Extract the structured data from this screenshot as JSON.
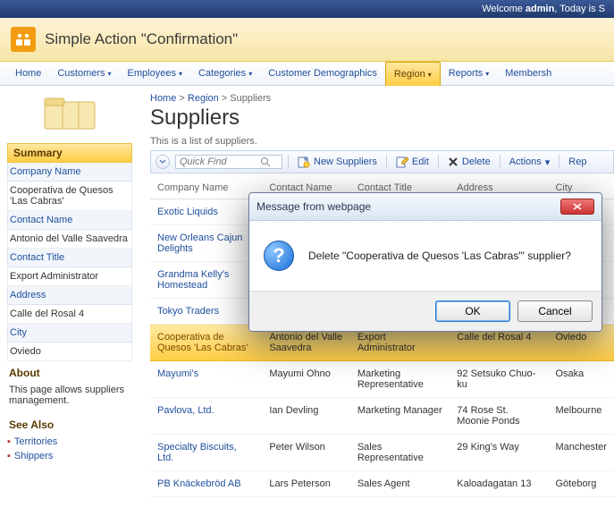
{
  "topbar": {
    "welcome": "Welcome ",
    "user": "admin",
    "today": ", Today is S"
  },
  "header": {
    "title": "Simple Action \"Confirmation\""
  },
  "nav": {
    "items": [
      {
        "label": "Home",
        "dd": false
      },
      {
        "label": "Customers",
        "dd": true
      },
      {
        "label": "Employees",
        "dd": true
      },
      {
        "label": "Categories",
        "dd": true
      },
      {
        "label": "Customer Demographics"
      },
      {
        "label": "Region",
        "dd": true,
        "active": true
      },
      {
        "label": "Reports",
        "dd": true
      },
      {
        "label": "Membersh"
      }
    ]
  },
  "sidebar": {
    "summary_title": "Summary",
    "fields": [
      {
        "label": "Company Name",
        "value": "Cooperativa de Quesos 'Las Cabras'"
      },
      {
        "label": "Contact Name",
        "value": "Antonio del Valle Saavedra"
      },
      {
        "label": "Contact Title",
        "value": "Export Administrator"
      },
      {
        "label": "Address",
        "value": "Calle del Rosal 4"
      },
      {
        "label": "City",
        "value": "Oviedo"
      }
    ],
    "about_title": "About",
    "about_text": "This page allows suppliers management.",
    "seealso_title": "See Also",
    "seealso": [
      "Territories",
      "Shippers"
    ]
  },
  "breadcrumb": {
    "a": "Home",
    "b": "Region",
    "c": "Suppliers"
  },
  "page": {
    "title": "Suppliers",
    "sub": "This is a list of suppliers."
  },
  "toolbar": {
    "search_placeholder": "Quick Find",
    "new": "New Suppliers",
    "edit": "Edit",
    "delete": "Delete",
    "actions": "Actions",
    "report": "Rep"
  },
  "columns": [
    "Company Name",
    "Contact Name",
    "Contact Title",
    "Address",
    "City"
  ],
  "rows": [
    {
      "c": [
        "Exotic Liquids",
        "",
        "",
        "",
        ""
      ]
    },
    {
      "c": [
        "New Orleans Cajun Delights",
        "",
        "",
        "",
        ""
      ]
    },
    {
      "c": [
        "Grandma Kelly's Homestead",
        "",
        "",
        "",
        ""
      ]
    },
    {
      "c": [
        "Tokyo Traders",
        "",
        "",
        "",
        ""
      ]
    },
    {
      "c": [
        "Cooperativa de Quesos 'Las Cabras'",
        "Antonio del Valle Saavedra",
        "Export Administrator",
        "Calle del Rosal 4",
        "Oviedo"
      ],
      "selected": true
    },
    {
      "c": [
        "Mayumi's",
        "Mayumi Ohno",
        "Marketing Representative",
        "92 Setsuko Chuo-ku",
        "Osaka"
      ]
    },
    {
      "c": [
        "Pavlova, Ltd.",
        "Ian Devling",
        "Marketing Manager",
        "74 Rose St. Moonie Ponds",
        "Melbourne"
      ]
    },
    {
      "c": [
        "Specialty Biscuits, Ltd.",
        "Peter Wilson",
        "Sales Representative",
        "29 King's Way",
        "Manchester"
      ]
    },
    {
      "c": [
        "PB Knäckebröd AB",
        "Lars Peterson",
        "Sales Agent",
        "Kaloadagatan 13",
        "Göteborg"
      ]
    }
  ],
  "dialog": {
    "title": "Message from webpage",
    "text": "Delete \"Cooperativa de Quesos 'Las Cabras'\" supplier?",
    "ok": "OK",
    "cancel": "Cancel"
  }
}
